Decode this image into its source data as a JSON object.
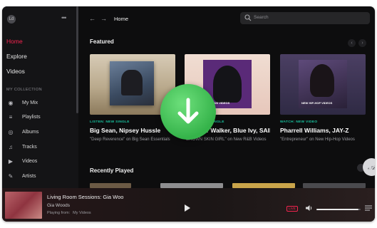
{
  "sidebar": {
    "avatar_text": "Ld",
    "nav": [
      {
        "label": "Home",
        "active": true
      },
      {
        "label": "Explore",
        "active": false
      },
      {
        "label": "Videos",
        "active": false
      }
    ],
    "section_label": "MY COLLECTION",
    "collection": [
      {
        "label": "My Mix",
        "icon": "radio-icon"
      },
      {
        "label": "Playlists",
        "icon": "playlist-icon"
      },
      {
        "label": "Albums",
        "icon": "album-icon"
      },
      {
        "label": "Tracks",
        "icon": "music-note-icon"
      },
      {
        "label": "Videos",
        "icon": "video-icon"
      },
      {
        "label": "Artists",
        "icon": "microphone-icon"
      }
    ]
  },
  "header": {
    "title": "Home",
    "search_placeholder": "Search"
  },
  "featured": {
    "title": "Featured",
    "cards": [
      {
        "tag": "LISTEN: NEW SINGLE",
        "title": "Big Sean, Nipsey Hussle",
        "desc": "\"Deep Reverence\" on Big Sean Essentials"
      },
      {
        "tag": "LISTEN: NEW SINGLE",
        "title": "Summer Walker, Blue Ivy, SAINt JHN",
        "desc": "\"BROWN SKIN GIRL\" on New R&B Videos"
      },
      {
        "tag": "WATCH: NEW VIDEO",
        "title": "Pharrell Williams, JAY-Z",
        "desc": "\"Entrepreneur\" on New Hip-Hop Videos"
      }
    ]
  },
  "recently_played": {
    "title": "Recently Played"
  },
  "player": {
    "title": "Living Room Sessions: Gia Woo",
    "artist": "Gia Woods",
    "from_label": "Playing from:",
    "from_value": "My Videos",
    "live_label": "LIVE",
    "volume": 0.95
  },
  "art_labels": {
    "card2": "NEW R&B VIDEOS",
    "card3": "NEW HIP-HOP VIDEOS"
  },
  "colors": {
    "accent": "#f5234f",
    "teal": "#19c4a0",
    "download": "#3dbb4f"
  }
}
